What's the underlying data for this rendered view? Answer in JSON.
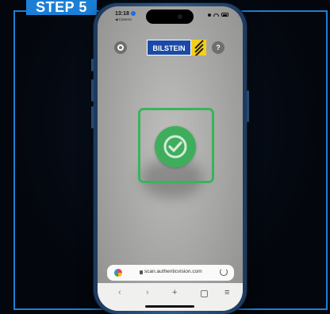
{
  "badge": {
    "label": "STEP 5"
  },
  "status_bar": {
    "time": "13:18",
    "back_label": "◀ Camera"
  },
  "header": {
    "brand": "BILSTEIN",
    "help_label": "?"
  },
  "scan": {
    "state": "verified",
    "accent": "#3fae5c"
  },
  "browser": {
    "url": "scan.authenticvision.com",
    "toolbar": {
      "back": "‹",
      "forward": "›",
      "add": "+",
      "menu": "≡"
    }
  },
  "colors": {
    "frame": "#1f7fd4",
    "badge": "#1b7fd6",
    "brand_blue": "#1a4aa6",
    "brand_yellow": "#f4cf18"
  },
  "icons": [
    "gear-icon",
    "help-icon",
    "check-icon",
    "lock-icon",
    "reload-icon",
    "tabs-icon"
  ]
}
